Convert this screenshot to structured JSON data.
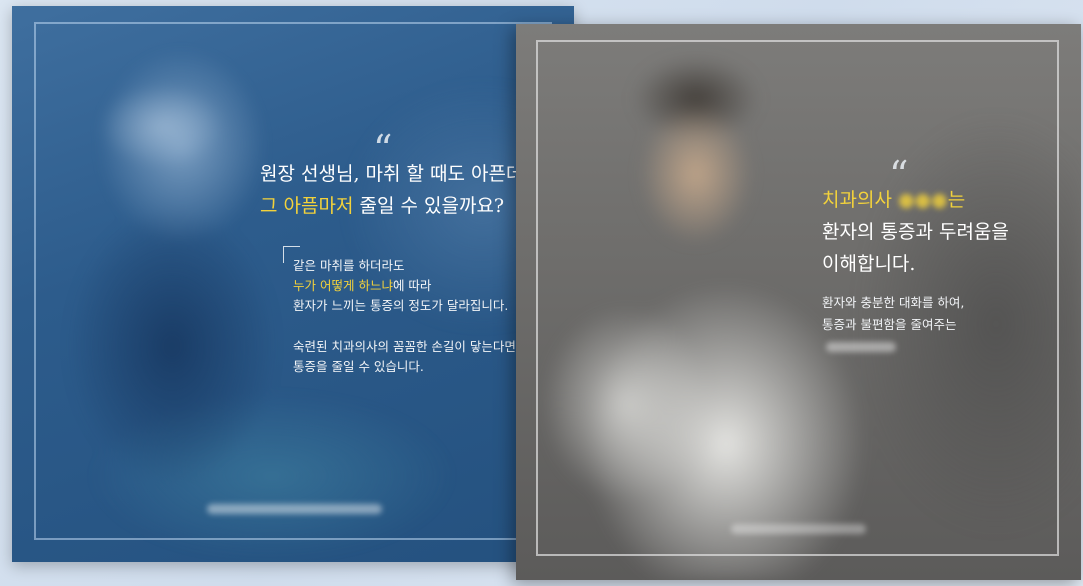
{
  "left_card": {
    "quote_mark": "“",
    "headline_line1": "원장 선생님, 마취 할 때도 아픈데",
    "headline_line2_highlight": "그 아픔마저",
    "headline_line2_rest": " 줄일 수 있을까요?",
    "body_line1": "같은 마취를 하더라도",
    "body_line2_highlight": "누가 어떻게 하느냐",
    "body_line2_rest": "에 따라",
    "body_line3": "환자가 느끼는 통증의 정도가 달라집니다.",
    "body_line4": "숙련된 치과의사의 꼼꼼한 손길이 닿는다면",
    "body_line5": "통증을 줄일 수 있습니다."
  },
  "right_card": {
    "quote_mark": "“",
    "headline_line1_highlight": "치과의사",
    "headline_line1_suffix": "는",
    "headline_line2": "환자의 통증과 두려움을",
    "headline_line3": "이해합니다.",
    "body_line1": "환자와 충분한 대화를 하여,",
    "body_line2": "통증과 불편함을 줄여주는"
  },
  "colors": {
    "accent_yellow": "#f3d23b",
    "left_bg": "#2d5c8c",
    "right_bg": "#6f6e6c"
  }
}
